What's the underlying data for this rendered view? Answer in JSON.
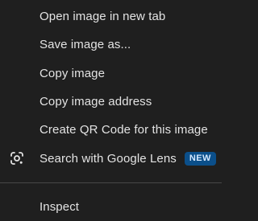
{
  "context_menu": {
    "items": [
      {
        "label": "Open image in new tab"
      },
      {
        "label": "Save image as..."
      },
      {
        "label": "Copy image"
      },
      {
        "label": "Copy image address"
      },
      {
        "label": "Create QR Code for this image"
      },
      {
        "label": "Search with Google Lens",
        "icon": "google-lens-icon",
        "badge": "NEW"
      },
      {
        "label": "Inspect"
      }
    ]
  },
  "colors": {
    "background": "#1f1f1f",
    "text": "#e3e3e3",
    "badge_background": "#0b4f8a",
    "badge_text": "#d4e8ff",
    "divider": "#474747"
  }
}
